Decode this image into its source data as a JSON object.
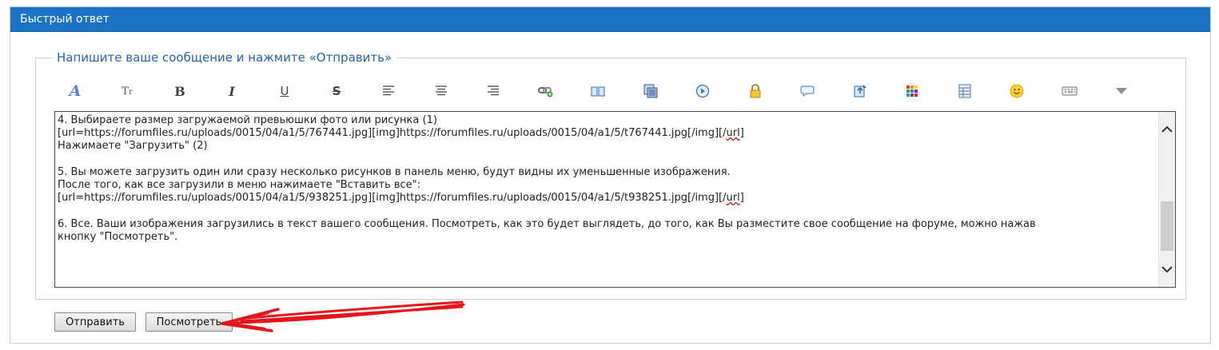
{
  "panel": {
    "title": "Быстрый ответ",
    "legend": "Напишите ваше сообщение и нажмите «Отправить»"
  },
  "toolbar": {
    "icons": [
      "font-icon",
      "font-size-icon",
      "bold-icon",
      "italic-icon",
      "underline-icon",
      "strikethrough-icon",
      "align-left-icon",
      "align-center-icon",
      "align-right-icon",
      "link-icon",
      "book-icon",
      "gallery-icon",
      "video-icon",
      "lock-icon",
      "speech-icon",
      "upload-icon",
      "color-palette-icon",
      "table-icon",
      "smiley-icon",
      "keyboard-icon",
      "more-dropdown-icon"
    ]
  },
  "editor": {
    "lines": [
      "4. Выбираете размер загружаемой превьюшки фото или рисунка (1)",
      "[url=https://forumfiles.ru/uploads/0015/04/a1/5/767441.jpg][img]https://forumfiles.ru/uploads/0015/04/a1/5/t767441.jpg[/img][/",
      "url",
      "]",
      "Нажимаете \"Загрузить\" (2)",
      "",
      "5. Вы можете загрузить один или сразу несколько рисунков в панель меню, будут видны их уменьшенные изображения.",
      "После того, как все загрузили в меню нажимаете \"Вставить все\":",
      "[url=https://forumfiles.ru/uploads/0015/04/a1/5/938251.jpg][img]https://forumfiles.ru/uploads/0015/04/a1/5/t938251.jpg[/img][/",
      "url",
      "]",
      "",
      "6. Все. Ваши изображения загрузились в текст вашего сообщения. Посмотреть, как это будет выглядеть, до того, как Вы разместите свое сообщение на форуме, можно нажав",
      "кнопку \"Посмотреть\"."
    ],
    "scroll_position": 0.55
  },
  "buttons": {
    "submit": "Отправить",
    "preview": "Посмотреть"
  },
  "colors": {
    "titlebar": "#1a73c4",
    "legend": "#2266aa",
    "annotation_arrow": "#e8141b"
  }
}
